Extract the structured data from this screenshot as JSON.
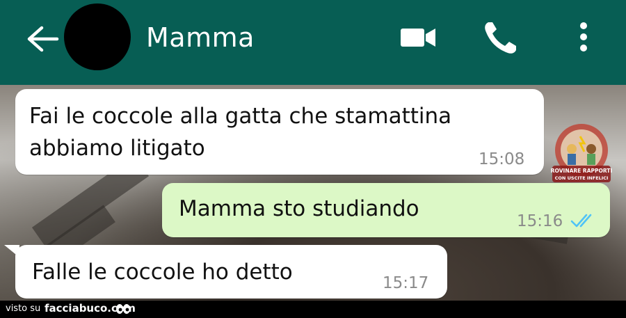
{
  "header": {
    "contact_name": "Mamma",
    "color": "#075e54"
  },
  "icons": {
    "back": "arrow-back-icon",
    "video": "video-camera-icon",
    "call": "phone-icon",
    "more": "more-vert-icon"
  },
  "messages": [
    {
      "direction": "incoming",
      "text_line1": "Fai le coccole alla gatta che stamattina",
      "text_line2": "abbiamo litigato",
      "time": "15:08"
    },
    {
      "direction": "outgoing",
      "text": "Mamma sto studiando",
      "time": "15:16",
      "status": "read"
    },
    {
      "direction": "incoming",
      "text": "Falle le coccole ho detto",
      "time": "15:17"
    }
  ],
  "watermark": {
    "line1": "ROVINARE RAPPORTI",
    "line2": "CON USCITE INFELICI"
  },
  "footer": {
    "visto": "visto su",
    "site": "facciabuco.com"
  },
  "colors": {
    "outgoing_bubble": "#dcf8c6",
    "incoming_bubble": "#ffffff",
    "read_ticks": "#4fc3f7"
  }
}
